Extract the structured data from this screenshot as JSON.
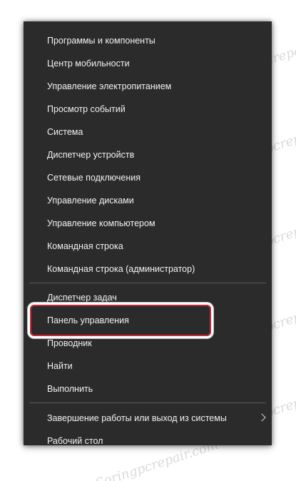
{
  "menu": {
    "items": [
      {
        "label": "Программы и компоненты"
      },
      {
        "label": "Центр мобильности"
      },
      {
        "label": "Управление электропитанием"
      },
      {
        "label": "Просмотр событий"
      },
      {
        "label": "Система"
      },
      {
        "label": "Диспетчер устройств"
      },
      {
        "label": "Сетевые подключения"
      },
      {
        "label": "Управление дисками"
      },
      {
        "label": "Управление компьютером"
      },
      {
        "label": "Командная строка"
      },
      {
        "label": "Командная строка (администратор)"
      },
      {
        "label": "Диспетчер задач"
      },
      {
        "label": "Панель управления"
      },
      {
        "label": "Проводник"
      },
      {
        "label": "Найти"
      },
      {
        "label": "Выполнить"
      },
      {
        "label": "Завершение работы или выход из системы"
      },
      {
        "label": "Рабочий стол"
      }
    ]
  },
  "highlighted_item": "Панель управления",
  "watermark": "Soringpcrepair.com",
  "colors": {
    "menu_bg": "#2b2b2b",
    "text": "#f2f2f2",
    "separator": "#5a5a5a",
    "highlight_border": "#c8283a"
  },
  "icons": {
    "submenu": "chevron-right-icon"
  }
}
